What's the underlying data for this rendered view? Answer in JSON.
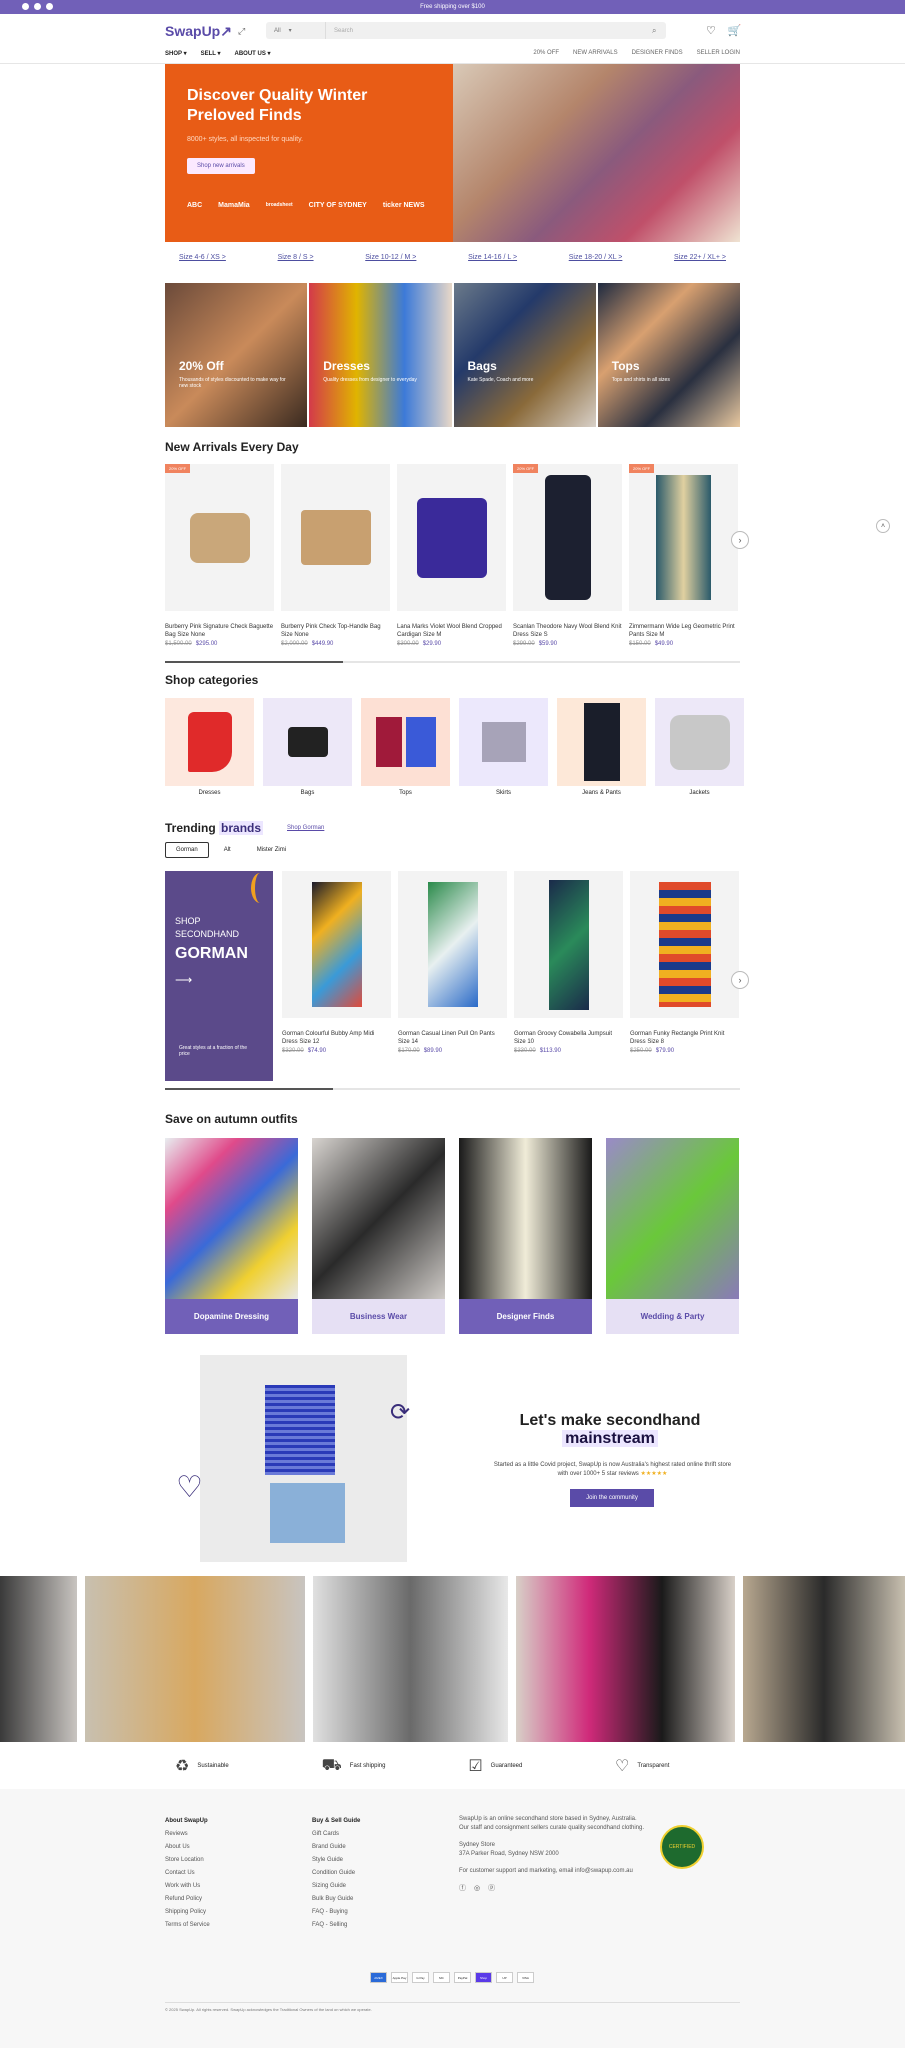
{
  "topbar": {
    "text": "Free shipping over $100"
  },
  "header": {
    "logo": "SwapUp",
    "search": {
      "category": "All",
      "placeholder": "Search"
    },
    "nav_left": [
      "SHOP",
      "SELL",
      "ABOUT US"
    ],
    "nav_right": [
      "20% OFF",
      "NEW ARRIVALS",
      "DESIGNER FINDS",
      "SELLER LOGIN"
    ]
  },
  "hero": {
    "title": "Discover Quality Winter Preloved Finds",
    "subtitle": "8000+ styles, all inspected for quality.",
    "button": "Shop new arrivals",
    "press": [
      "ABC",
      "MamaMia",
      "broadsheet",
      "CITY OF SYDNEY",
      "ticker NEWS"
    ]
  },
  "sizes": [
    "Size 4-6 / XS >",
    "Size 8 / S >",
    "Size 10-12 / M >",
    "Size 14-16 / L >",
    "Size 18-20 / XL >",
    "Size 22+ / XL+ >"
  ],
  "category_tiles": [
    {
      "title": "20% Off",
      "desc": "Thousands of styles discounted to make way for new stock"
    },
    {
      "title": "Dresses",
      "desc": "Quality dresses from designer to everyday"
    },
    {
      "title": "Bags",
      "desc": "Kate Spade, Coach and more"
    },
    {
      "title": "Tops",
      "desc": "Tops and shirts in all sizes"
    }
  ],
  "new_arrivals": {
    "title": "New Arrivals Every Day",
    "products": [
      {
        "name": "Burberry Pink Signature Check Baguette Bag Size None",
        "old": "$1,500.00",
        "price": "$295.00",
        "sale": "20% OFF"
      },
      {
        "name": "Burberry Pink Check Top-Handle Bag Size None",
        "old": "$2,000.00",
        "price": "$449.90",
        "sale": ""
      },
      {
        "name": "Lana Marks Violet Wool Blend Cropped Cardigan Size M",
        "old": "$300.00",
        "price": "$29.90",
        "sale": ""
      },
      {
        "name": "Scanlan Theodore Navy Wool Blend Knit Dress Size S",
        "old": "$299.00",
        "price": "$59.90",
        "sale": "20% OFF"
      },
      {
        "name": "Zimmermann Wide Leg Geometric Print Pants Size M",
        "old": "$150.00",
        "price": "$49.90",
        "sale": "20% OFF"
      }
    ]
  },
  "shop_categories": {
    "title": "Shop categories",
    "items": [
      "Dresses",
      "Bags",
      "Tops",
      "Skirts",
      "Jeans & Pants",
      "Jackets"
    ]
  },
  "trending": {
    "title_a": "Trending",
    "title_b": "brands",
    "link": "Shop Gorman",
    "tabs": [
      "Gorman",
      "Alt",
      "Mister Zimi"
    ],
    "promo": {
      "line1": "SHOP",
      "line2": "SECONDHAND",
      "brand": "GORMAN",
      "desc": "Great styles at a fraction of the price"
    },
    "products": [
      {
        "name": "Gorman Colourful Bubby Amp Midi Dress Size 12",
        "old": "$320.00",
        "price": "$74.90"
      },
      {
        "name": "Gorman Casual Linen Pull On Pants Size 14",
        "old": "$170.00",
        "price": "$89.90"
      },
      {
        "name": "Gorman Groovy Cowabella Jumpsuit Size 10",
        "old": "$330.00",
        "price": "$113.90"
      },
      {
        "name": "Gorman Funky Rectangle Print Knit Dress Size 8",
        "old": "$250.00",
        "price": "$79.90"
      }
    ]
  },
  "outfits": {
    "title": "Save on autumn outfits",
    "items": [
      "Dopamine Dressing",
      "Business Wear",
      "Designer Finds",
      "Wedding & Party"
    ]
  },
  "community": {
    "title_a": "Let's make secondhand",
    "title_b": "mainstream",
    "desc": "Started as a little Covid project, SwapUp is now Australia's highest rated online thrift store with over 1000+ 5 star reviews",
    "stars": "★★★★★",
    "button": "Join the community"
  },
  "features": [
    "Sustainable",
    "Fast shipping",
    "Guaranteed",
    "Transparent"
  ],
  "footer": {
    "col1": {
      "heading": "About SwapUp",
      "links": [
        "Reviews",
        "About Us",
        "Store Location",
        "Contact Us",
        "Work with Us",
        "Refund Policy",
        "Shipping Policy",
        "Terms of Service"
      ]
    },
    "col2": {
      "heading": "Buy & Sell Guide",
      "links": [
        "Gift Cards",
        "Brand Guide",
        "Style Guide",
        "Condition Guide",
        "Sizing Guide",
        "Bulk Buy Guide",
        "FAQ - Buying",
        "FAQ - Selling"
      ]
    },
    "about": "SwapUp is an online secondhand store based in Sydney, Australia. Our staff and consignment sellers curate quality secondhand clothing.",
    "address_label": "Sydney Store",
    "address": "37A Parker Road, Sydney NSW 2000",
    "email_line": "For customer support and marketing, email info@swapup.com.au",
    "badge": "CERTIFIED",
    "payments": [
      "AMEX",
      "Apple Pay",
      "G Pay",
      "MC",
      "PayPal",
      "Shop",
      "UP",
      "VISA"
    ],
    "copyright": "© 2025 SwapUp. All rights reserved. SwapUp acknowledges the Traditional Owners of the land on which we operate."
  }
}
